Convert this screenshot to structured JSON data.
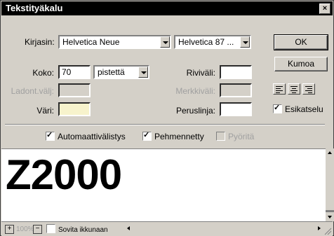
{
  "window": {
    "title": "Tekstityäkalu",
    "close_glyph": "×"
  },
  "font": {
    "label": "Kirjasin:",
    "family": "Helvetica Neue",
    "style": "Helvetica 87 ..."
  },
  "size": {
    "label": "Koko:",
    "value": "70",
    "unit": "pistettä"
  },
  "tracking": {
    "label": "Ladont.välj:",
    "value": ""
  },
  "color": {
    "label": "Väri:",
    "value": "#f7f3cc"
  },
  "leading": {
    "label": "Riviväli:",
    "value": ""
  },
  "kerning": {
    "label": "Merkkiväli:",
    "value": ""
  },
  "baseline": {
    "label": "Peruslinja:",
    "value": ""
  },
  "buttons": {
    "ok": "OK",
    "cancel": "Kumoa"
  },
  "preview_toggle": {
    "label": "Esikatselu",
    "checked": true
  },
  "options": [
    {
      "label": "Automaattivälistys",
      "checked": true,
      "enabled": true
    },
    {
      "label": "Pehmennetty",
      "checked": true,
      "enabled": true
    },
    {
      "label": "Pyöritä",
      "checked": false,
      "enabled": false
    }
  ],
  "preview": {
    "text": "Z2000"
  },
  "statusbar": {
    "zoom": "100%",
    "zoom_in": "+",
    "zoom_out": "−",
    "fit_label": "Sovita ikkunaan"
  }
}
